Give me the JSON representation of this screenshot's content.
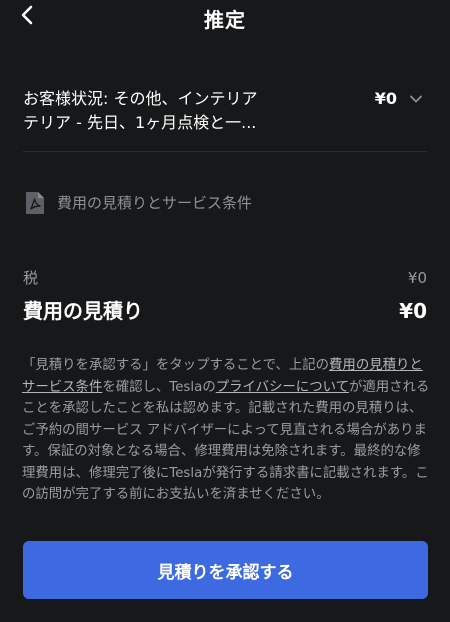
{
  "header": {
    "title": "推定"
  },
  "service": {
    "line1": "お客様状況: その他、インテリア",
    "line2": "テリア - 先日、1ヶ月点検と一...",
    "price": "¥0"
  },
  "document_link": {
    "label": "費用の見積りとサービス条件"
  },
  "summary": {
    "tax_label": "税",
    "tax_value": "¥0",
    "total_label": "費用の見積り",
    "total_value": "¥0"
  },
  "terms": {
    "part1": "「見積りを承認する」をタップすることで、上記の",
    "link1": "費用の見積りとサービス条件",
    "part2": "を確認し、Teslaの",
    "link2": "プライバシーについて",
    "part3": "が適用されることを承認したことを私は認めます。記載された費用の見積りは、ご予約の間サービス アドバイザーによって見直される場合があります。保証の対象となる場合、修理費用は免除されます。最終的な修理費用は、修理完了後にTeslaが発行する請求書に記載されます。この訪問が完了する前にお支払いを済ませください。"
  },
  "approve_button": {
    "label": "見積りを承認する"
  },
  "colors": {
    "background": "#17181a",
    "accent": "#3e6ae1"
  },
  "icons": {
    "back": "chevron-left-icon",
    "expand": "chevron-down-icon",
    "document": "pdf-icon"
  }
}
